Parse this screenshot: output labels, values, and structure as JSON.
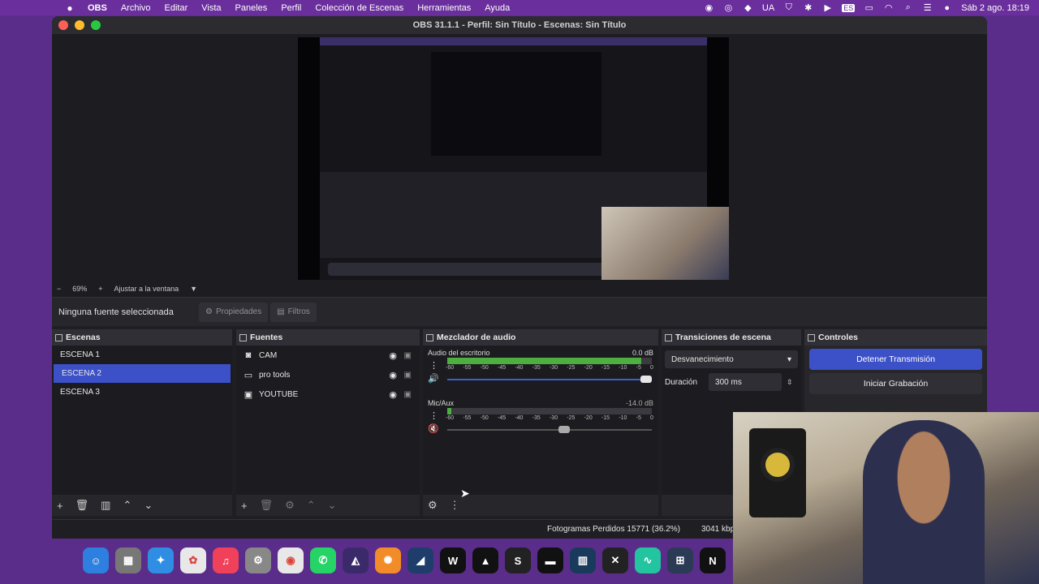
{
  "menubar": {
    "app": "OBS",
    "items": [
      "Archivo",
      "Editar",
      "Vista",
      "Paneles",
      "Perfil",
      "Colección de Escenas",
      "Herramientas",
      "Ayuda"
    ],
    "input_source": "UA",
    "keyboard": "ES",
    "clock": "Sáb 2 ago.  18:19"
  },
  "window": {
    "title": "OBS 31.1.1 - Perfil: Sin Título - Escenas: Sin Título"
  },
  "preview": {
    "zoom": "69%",
    "fit_label": "Ajustar a la ventana"
  },
  "propbar": {
    "no_selection": "Ninguna fuente seleccionada",
    "properties": "Propiedades",
    "filters": "Filtros"
  },
  "scenes": {
    "title": "Escenas",
    "items": [
      "ESCENA 1",
      "ESCENA 2",
      "ESCENA 3"
    ],
    "selected": "ESCENA 2"
  },
  "sources": {
    "title": "Fuentes",
    "items": [
      {
        "label": "CAM",
        "icon": "camera-icon"
      },
      {
        "label": "pro tools",
        "icon": "monitor-icon"
      },
      {
        "label": "YOUTUBE",
        "icon": "window-icon"
      }
    ]
  },
  "mixer": {
    "title": "Mezclador de audio",
    "ticks": [
      "-60",
      "-55",
      "-50",
      "-45",
      "-40",
      "-35",
      "-30",
      "-25",
      "-20",
      "-15",
      "-10",
      "-5",
      "0"
    ],
    "channels": [
      {
        "name": "Audio del escritorio",
        "level": "0.0 dB",
        "meter_fill": 0.95,
        "volume": 1.0
      },
      {
        "name": "Mic/Aux",
        "level": "-14.0 dB",
        "meter_fill": 0.02,
        "volume": 0.6
      }
    ]
  },
  "transitions": {
    "title": "Transiciones de escena",
    "selected": "Desvanecimiento",
    "duration_label": "Duración",
    "duration_value": "300 ms"
  },
  "controls": {
    "title": "Controles",
    "stop_stream": "Detener Transmisión",
    "start_recording": "Iniciar Grabación"
  },
  "status": {
    "frames": "Fotogramas Perdidos 15771 (36.2%)",
    "bitrate": "3041 kbp"
  },
  "colors": {
    "accent": "#3c50c8",
    "panel": "#26262b",
    "menubar": "#6a2f9c"
  },
  "dock_apps": [
    "finder-icon",
    "launchpad-icon",
    "safari-icon",
    "photos-icon",
    "music-icon",
    "system-settings-icon",
    "chrome-icon",
    "whatsapp-icon",
    "obs-icon",
    "fl-studio-icon",
    "app-icon",
    "waves-icon",
    "app-icon",
    "app-icon",
    "app-icon",
    "app-icon",
    "app-icon",
    "app-icon",
    "app-icon",
    "native-instruments-icon"
  ]
}
